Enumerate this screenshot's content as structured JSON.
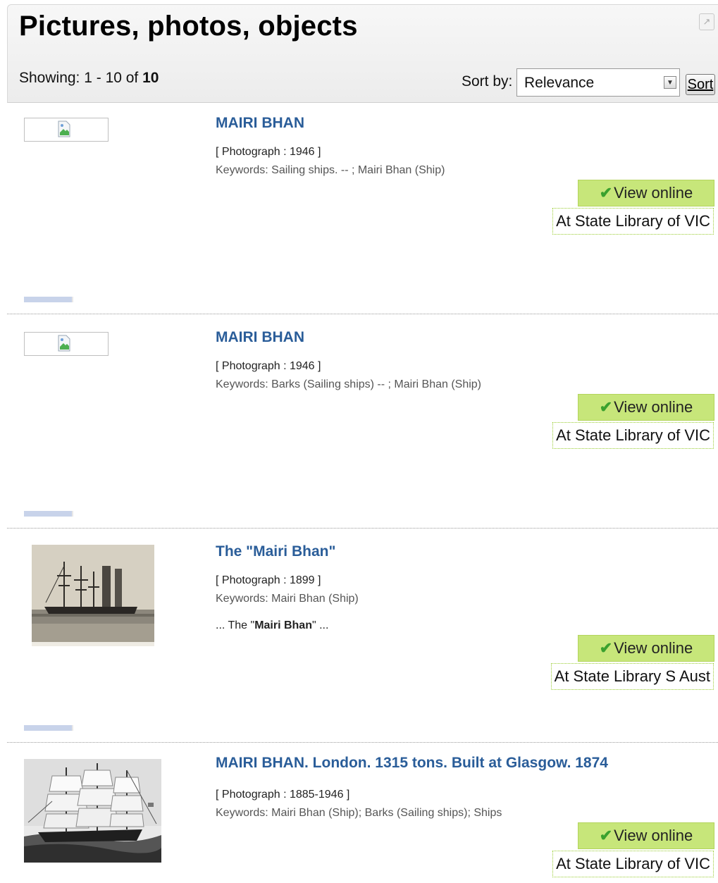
{
  "header": {
    "title": "Pictures, photos, objects",
    "showing_prefix": "Showing: 1 - 10 of ",
    "showing_total": "10",
    "sort_label": "Sort by:",
    "sort_value": "Relevance",
    "sort_button": "Sort"
  },
  "results": [
    {
      "title": "MAIRI BHAN",
      "type": "[ Photograph : 1946 ]",
      "keywords": "Keywords: Sailing ships. -- ; Mairi Bhan (Ship)",
      "view_label": "View online",
      "library": "At State Library of VIC"
    },
    {
      "title": "MAIRI BHAN",
      "type": "[ Photograph : 1946 ]",
      "keywords": "Keywords: Barks (Sailing ships) -- ; Mairi Bhan (Ship)",
      "view_label": "View online",
      "library": "At State Library of VIC"
    },
    {
      "title": "The \"Mairi Bhan\"",
      "type": "[ Photograph : 1899 ]",
      "keywords": "Keywords: Mairi Bhan (Ship)",
      "snippet_prefix": "... The \"",
      "snippet_bold": "Mairi Bhan",
      "snippet_suffix": "\" ...",
      "view_label": "View online",
      "library": "At State Library S Aust"
    },
    {
      "title": "MAIRI BHAN. London. 1315 tons. Built at Glasgow. 1874",
      "type": "[ Photograph : 1885-1946 ]",
      "keywords": "Keywords: Mairi Bhan (Ship); Barks (Sailing ships); Ships",
      "view_label": "View online",
      "library": "At State Library of VIC"
    }
  ],
  "icons": {
    "expand": "external-expand-icon",
    "check": "check-icon",
    "broken_image": "broken-image-icon"
  }
}
